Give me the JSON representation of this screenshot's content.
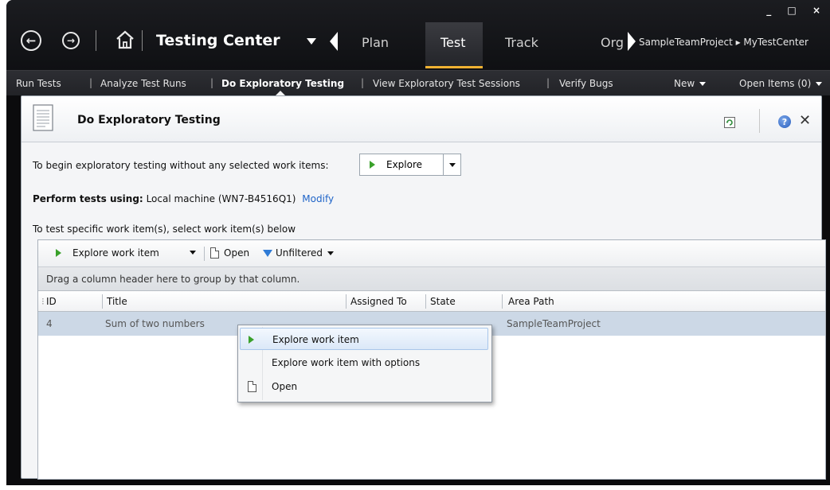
{
  "window": {
    "controls": "_ □ ×"
  },
  "header": {
    "app_title": "Testing Center",
    "tabs": [
      {
        "label": "Plan"
      },
      {
        "label": "Test"
      },
      {
        "label": "Track"
      },
      {
        "label": "Org"
      }
    ],
    "project_path": "SampleTeamProject ▸ MyTestCenter"
  },
  "subnav": {
    "items": [
      {
        "label": "Run Tests"
      },
      {
        "label": "Analyze Test Runs"
      },
      {
        "label": "Do Exploratory Testing"
      },
      {
        "label": "View Exploratory Test Sessions"
      },
      {
        "label": "Verify Bugs"
      }
    ],
    "new_label": "New",
    "open_items_label": "Open Items (0)"
  },
  "panel": {
    "title": "Do Exploratory Testing",
    "begin_text": "To begin exploratory testing without any selected work items:",
    "explore_label": "Explore",
    "perform_label": "Perform tests using:",
    "perform_value": "Local machine (WN7-B4516Q1)",
    "modify_label": "Modify",
    "specific_text": "To test specific work item(s), select work item(s) below"
  },
  "toolbar": {
    "explore_work_item": "Explore work item",
    "open": "Open",
    "unfiltered": "Unfiltered"
  },
  "grid": {
    "group_hint": "Drag a column header here to group by that column.",
    "columns": [
      "ID",
      "Title",
      "Assigned To",
      "State",
      "Area Path"
    ],
    "rows": [
      {
        "id": "4",
        "title": "Sum of two numbers",
        "area_path": "SampleTeamProject"
      }
    ]
  },
  "context_menu": {
    "items": [
      {
        "label": "Explore work item"
      },
      {
        "label": "Explore work item with options"
      },
      {
        "label": "Open"
      }
    ]
  }
}
